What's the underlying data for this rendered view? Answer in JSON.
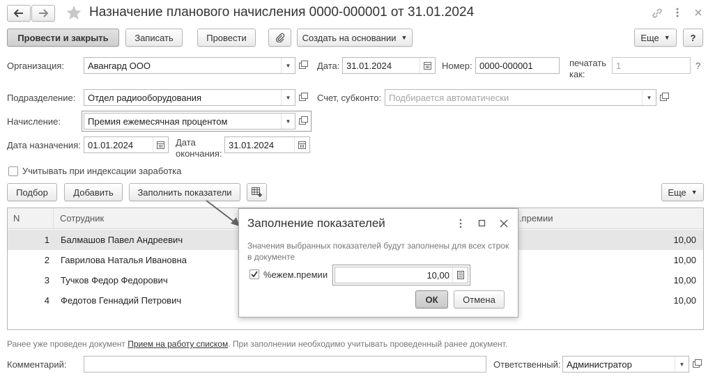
{
  "window": {
    "title": "Назначение планового начисления 0000-000001 от 31.01.2024"
  },
  "toolbar": {
    "post_close": "Провести и закрыть",
    "write": "Записать",
    "post": "Провести",
    "create_based": "Создать на основании",
    "more": "Еще",
    "help": "?"
  },
  "form": {
    "org_label": "Организация:",
    "org_value": "Авангард ООО",
    "date_label": "Дата:",
    "date_value": "31.01.2024",
    "number_label": "Номер:",
    "number_value": "0000-000001",
    "print_as_label_1": "печатать",
    "print_as_label_2": "как:",
    "print_as_placeholder": "1",
    "print_as_help": "?",
    "dept_label": "Подразделение:",
    "dept_value": "Отдел радиооборудования",
    "account_label": "Счет, субконто:",
    "account_placeholder": "Подбирается автоматически",
    "accrual_label": "Начисление:",
    "accrual_value": "Премия ежемесячная процентом",
    "assign_date_label": "Дата назначения:",
    "assign_date_value": "01.01.2024",
    "end_date_label_1": "Дата",
    "end_date_label_2": "окончания:",
    "end_date_value": "31.01.2024",
    "indexation_label": "Учитывать при индексации заработка",
    "indexation_checked": false
  },
  "table_toolbar": {
    "pick": "Подбор",
    "add": "Добавить",
    "fill_indicators": "Заполнить показатели",
    "more": "Еще"
  },
  "table": {
    "columns": [
      "N",
      "Сотрудник",
      "м.премии"
    ],
    "rows": [
      {
        "n": "1",
        "employee": "Балмашов Павел Андреевич",
        "value": "10,00"
      },
      {
        "n": "2",
        "employee": "Гаврилова Наталья Ивановна",
        "value": "10,00"
      },
      {
        "n": "3",
        "employee": "Тучков Федор Федорович",
        "value": "10,00"
      },
      {
        "n": "4",
        "employee": "Федотов Геннадий Петрович",
        "value": "10,00"
      }
    ],
    "selected_row": 0
  },
  "dialog": {
    "title": "Заполнение показателей",
    "description": "Значения выбранных показателей будут заполнены для всех строк в документе",
    "indicator_label": "%ежем.премии",
    "indicator_checked": true,
    "indicator_value": "10,00",
    "ok": "ОК",
    "cancel": "Отмена"
  },
  "footer": {
    "note_prefix": "Ранее уже проведен документ ",
    "note_link": "Прием на работу списком",
    "note_suffix": ". При заполнении необходимо учитывать проведенный ранее документ.",
    "comment_label": "Комментарий:",
    "comment_value": "",
    "responsible_label": "Ответственный:",
    "responsible_value": "Администратор"
  }
}
